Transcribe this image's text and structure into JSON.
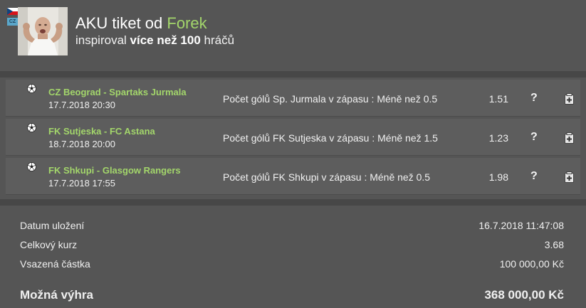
{
  "header": {
    "badge": "CZ",
    "title_prefix": "AKU tiket od",
    "username": "Forek",
    "subtitle_prefix": "inspiroval",
    "subtitle_bold": "více než 100",
    "subtitle_suffix": "hráčů"
  },
  "bets": [
    {
      "match": "CZ Beograd - Spartaks Jurmala",
      "date": "17.7.2018 20:30",
      "market": "Počet gólů Sp. Jurmala v zápasu : Méně než 0.5",
      "odds": "1.51",
      "help": "?"
    },
    {
      "match": "FK Sutjeska - FC Astana",
      "date": "18.7.2018 20:00",
      "market": "Počet gólů FK Sutjeska v zápasu : Méně než 1.5",
      "odds": "1.23",
      "help": "?"
    },
    {
      "match": "FK Shkupi - Glasgow Rangers",
      "date": "17.7.2018 17:55",
      "market": "Počet gólů FK Shkupi v zápasu : Méně než 0.5",
      "odds": "1.98",
      "help": "?"
    }
  ],
  "summary": {
    "saved_label": "Datum uložení",
    "saved_value": "16.7.2018 11:47:08",
    "total_odds_label": "Celkový kurz",
    "total_odds_value": "3.68",
    "stake_label": "Vsazená částka",
    "stake_value": "100 000,00 Kč",
    "win_label": "Možná výhra",
    "win_value": "368 000,00 Kč"
  },
  "colors": {
    "background": "#555555",
    "accent_green": "#a3d66b",
    "divider": "#474747"
  },
  "icons": [
    "soccer-ball-icon",
    "help-icon",
    "add-to-ticket-icon",
    "flag-cz-icon"
  ]
}
